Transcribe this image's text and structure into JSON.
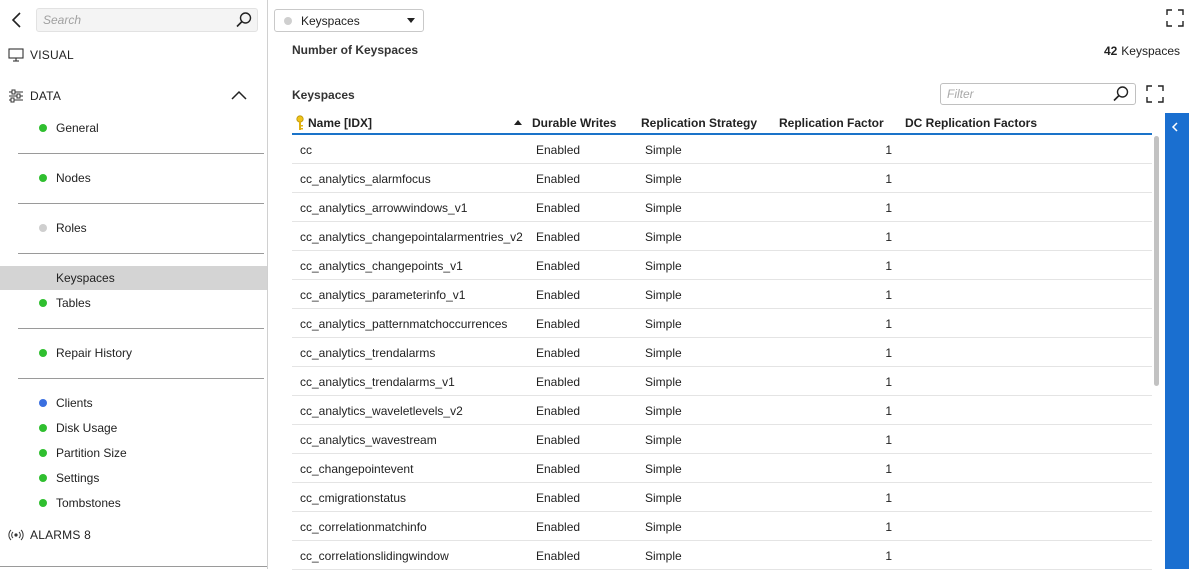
{
  "sidebar": {
    "search_placeholder": "Search",
    "visual_label": "VISUAL",
    "data_label": "DATA",
    "alarms_label": "ALARMS 8",
    "items": [
      {
        "label": "General",
        "dot_color": "#2fbf2f"
      },
      {
        "label": "Nodes",
        "dot_color": "#2fbf2f"
      },
      {
        "label": "Roles",
        "dot_color": "#cfcfcf"
      },
      {
        "label": "Keyspaces",
        "dot_color": ""
      },
      {
        "label": "Tables",
        "dot_color": "#2fbf2f"
      },
      {
        "label": "Repair History",
        "dot_color": "#2fbf2f"
      },
      {
        "label": "Clients",
        "dot_color": "#3a6fe0"
      },
      {
        "label": "Disk Usage",
        "dot_color": "#2fbf2f"
      },
      {
        "label": "Partition Size",
        "dot_color": "#2fbf2f"
      },
      {
        "label": "Settings",
        "dot_color": "#2fbf2f"
      },
      {
        "label": "Tombstones",
        "dot_color": "#2fbf2f"
      }
    ]
  },
  "main": {
    "dropdown_value": "Keyspaces",
    "count_title": "Number of Keyspaces",
    "count_value": "42",
    "count_unit": "Keyspaces",
    "section_title": "Keyspaces",
    "filter_placeholder": "Filter",
    "columns": [
      "Name [IDX]",
      "Durable Writes",
      "Replication Strategy",
      "Replication Factor",
      "DC Replication Factors"
    ],
    "rows": [
      [
        "cc",
        "Enabled",
        "Simple",
        "1",
        ""
      ],
      [
        "cc_analytics_alarmfocus",
        "Enabled",
        "Simple",
        "1",
        ""
      ],
      [
        "cc_analytics_arrowwindows_v1",
        "Enabled",
        "Simple",
        "1",
        ""
      ],
      [
        "cc_analytics_changepointalarmentries_v2",
        "Enabled",
        "Simple",
        "1",
        ""
      ],
      [
        "cc_analytics_changepoints_v1",
        "Enabled",
        "Simple",
        "1",
        ""
      ],
      [
        "cc_analytics_parameterinfo_v1",
        "Enabled",
        "Simple",
        "1",
        ""
      ],
      [
        "cc_analytics_patternmatchoccurrences",
        "Enabled",
        "Simple",
        "1",
        ""
      ],
      [
        "cc_analytics_trendalarms",
        "Enabled",
        "Simple",
        "1",
        ""
      ],
      [
        "cc_analytics_trendalarms_v1",
        "Enabled",
        "Simple",
        "1",
        ""
      ],
      [
        "cc_analytics_waveletlevels_v2",
        "Enabled",
        "Simple",
        "1",
        ""
      ],
      [
        "cc_analytics_wavestream",
        "Enabled",
        "Simple",
        "1",
        ""
      ],
      [
        "cc_changepointevent",
        "Enabled",
        "Simple",
        "1",
        ""
      ],
      [
        "cc_cmigrationstatus",
        "Enabled",
        "Simple",
        "1",
        ""
      ],
      [
        "cc_correlationmatchinfo",
        "Enabled",
        "Simple",
        "1",
        ""
      ],
      [
        "cc_correlationslidingwindow",
        "Enabled",
        "Simple",
        "1",
        ""
      ]
    ]
  },
  "colors": {
    "accent": "#1a6fd0",
    "active_item_bg": "#d4d4d4",
    "ok_dot": "#2fbf2f",
    "info_dot": "#3a6fe0",
    "inactive_dot": "#cfcfcf"
  }
}
